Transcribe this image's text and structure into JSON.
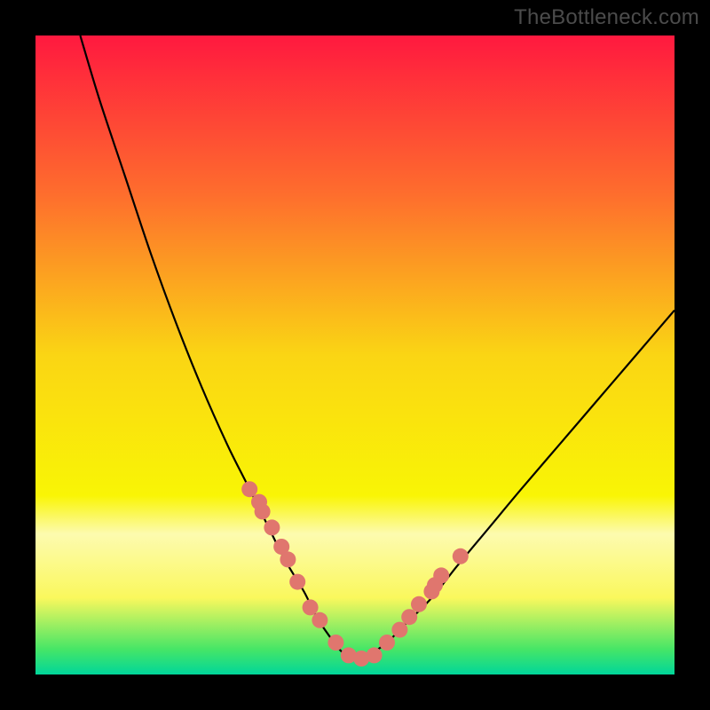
{
  "watermark": "TheBottleneck.com",
  "chart_data": {
    "type": "line",
    "title": "",
    "xlabel": "",
    "ylabel": "",
    "xlim": [
      0,
      100
    ],
    "ylim": [
      0,
      100
    ],
    "grid": false,
    "legend": false,
    "background_gradient": {
      "stops": [
        {
          "offset": 0.0,
          "color": "#ff193f"
        },
        {
          "offset": 0.25,
          "color": "#fe6e2d"
        },
        {
          "offset": 0.5,
          "color": "#fad514"
        },
        {
          "offset": 0.72,
          "color": "#f9f505"
        },
        {
          "offset": 0.78,
          "color": "#fdfbaf"
        },
        {
          "offset": 0.88,
          "color": "#faf85d"
        },
        {
          "offset": 0.96,
          "color": "#47e666"
        },
        {
          "offset": 1.0,
          "color": "#00d69a"
        }
      ]
    },
    "series": [
      {
        "name": "bottleneck-curve",
        "type": "line",
        "color": "#000000",
        "x": [
          7.0,
          10.0,
          14.0,
          18.0,
          22.0,
          26.0,
          30.0,
          33.0,
          36.0,
          39.0,
          42.0,
          44.0,
          46.0,
          48.0,
          50.0,
          52.0,
          55.0,
          58.0,
          62.0,
          66.0,
          71.0,
          76.0,
          82.0,
          88.0,
          94.0,
          100.0
        ],
        "y": [
          100.0,
          90.0,
          78.0,
          66.0,
          55.0,
          45.0,
          36.0,
          30.0,
          24.0,
          18.0,
          13.0,
          9.0,
          6.0,
          3.5,
          2.5,
          3.0,
          5.0,
          8.0,
          12.0,
          17.0,
          23.0,
          29.0,
          36.0,
          43.0,
          50.0,
          57.0
        ]
      },
      {
        "name": "bead-markers",
        "type": "scatter",
        "color": "#e0766e",
        "radius": 9,
        "x": [
          33.5,
          35.0,
          35.5,
          37.0,
          38.5,
          39.5,
          41.0,
          43.0,
          44.5,
          47.0,
          49.0,
          51.0,
          53.0,
          55.0,
          57.0,
          58.5,
          60.0,
          62.0,
          62.5,
          63.5,
          66.5
        ],
        "y": [
          29.0,
          27.0,
          25.5,
          23.0,
          20.0,
          18.0,
          14.5,
          10.5,
          8.5,
          5.0,
          3.0,
          2.5,
          3.0,
          5.0,
          7.0,
          9.0,
          11.0,
          13.0,
          14.0,
          15.5,
          18.5
        ]
      }
    ]
  }
}
